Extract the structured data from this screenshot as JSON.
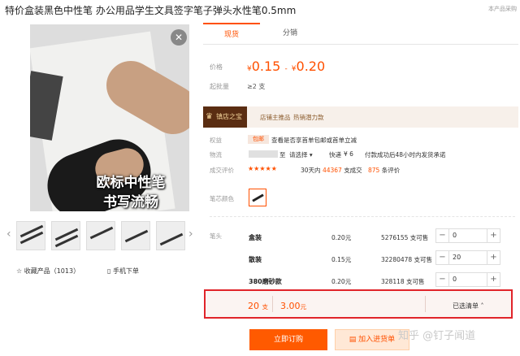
{
  "product": {
    "title": "特价盒装黑色中性笔 办公用品学生文具签字笔子弹头水性笔0.5mm",
    "top_right_note": "本产品采购",
    "overlay_line1": "欧标中性笔",
    "overlay_line2": "书写流畅",
    "close_glyph": "✕",
    "thumb_prev": "‹",
    "thumb_next": "›",
    "favorite_label": "收藏产品（1013）",
    "phone_order_label": "手机下单"
  },
  "tabs": [
    {
      "label": "现货",
      "active": true
    },
    {
      "label": "分销",
      "active": false
    }
  ],
  "pricing": {
    "price_label": "价格",
    "price_from": "0.15",
    "price_to": "0.20",
    "currency": "¥",
    "range_sep": "-",
    "min_qty_label": "起批量",
    "min_qty_value": "≥2 支"
  },
  "shop": {
    "badge": "镇店之宝",
    "tag1": "店铺主推品",
    "tag2": "热销潜力款"
  },
  "rights": {
    "label": "权益",
    "tag": "包邮",
    "text": "查看是否享首单包邮或首单立减"
  },
  "logistics": {
    "label": "物流",
    "to_label": "至",
    "select_label": "请选择 ▾",
    "express": "快递",
    "fee": "¥ 6",
    "note": "付款成功后48小时内发货承诺"
  },
  "reviews": {
    "label": "成交评价",
    "stars": "★★★★★",
    "days_prefix": "30天内",
    "deals": "44367",
    "deals_suffix": "支成交",
    "review_count": "875",
    "review_suffix": "条评价"
  },
  "color": {
    "label": "笔芯颜色"
  },
  "spec": {
    "label": "笔头",
    "rows": [
      {
        "name": "盒装",
        "price": "0.20元",
        "stock": "5276155 支可售",
        "qty": "0"
      },
      {
        "name": "散装",
        "price": "0.15元",
        "stock": "32280478 支可售",
        "qty": "20"
      },
      {
        "name": "380磨砂款",
        "price": "0.20元",
        "stock": "328118 支可售",
        "qty": "0"
      }
    ],
    "minus": "−",
    "plus": "+"
  },
  "summary": {
    "qty": "20",
    "qty_unit": "支",
    "total": "3.00",
    "total_unit": "元",
    "list_label": "已选清单 ˄"
  },
  "actions": {
    "buy_now": "立即订购",
    "add_cart": "加入进货单"
  },
  "watermark": "知乎 @钉子闻道",
  "colors": {
    "accent": "#ff5000",
    "highlight_border": "#e0242a",
    "shop_badge": "#5a2d12"
  }
}
